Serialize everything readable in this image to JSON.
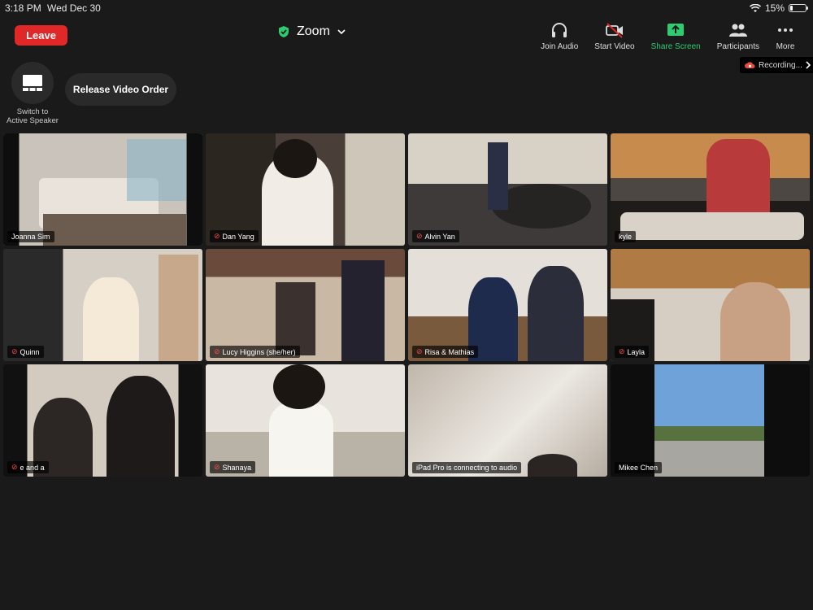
{
  "status": {
    "time": "3:18 PM",
    "date": "Wed Dec 30",
    "battery": "15%",
    "wifi_icon": "wifi-icon"
  },
  "toolbar": {
    "leave_label": "Leave",
    "meeting_title": "Zoom",
    "join_audio": "Join Audio",
    "start_video": "Start Video",
    "share_screen": "Share Screen",
    "participants": "Participants",
    "more": "More",
    "colors": {
      "leave": "#e02828",
      "share": "#2ecc71",
      "active": "#3bd16f"
    }
  },
  "recording_label": "Recording...",
  "view": {
    "switch_label_1": "Switch to",
    "switch_label_2": "Active Speaker",
    "release_label": "Release Video Order"
  },
  "participants": [
    {
      "name": "Joanna Sim",
      "muted": false
    },
    {
      "name": "Dan Yang",
      "muted": true
    },
    {
      "name": "Alvin Yan",
      "muted": true
    },
    {
      "name": "kyle",
      "muted": false
    },
    {
      "name": "Quinn",
      "muted": true
    },
    {
      "name": "Lucy Higgins (she/her)",
      "muted": true
    },
    {
      "name": "Risa & Mathias",
      "muted": true
    },
    {
      "name": "Layla",
      "muted": true
    },
    {
      "name": "e and a",
      "muted": true
    },
    {
      "name": "Shanaya",
      "muted": true
    },
    {
      "name": "iPad Pro is connecting to audio",
      "muted": false
    },
    {
      "name": "Mikee Chen",
      "muted": false
    }
  ]
}
